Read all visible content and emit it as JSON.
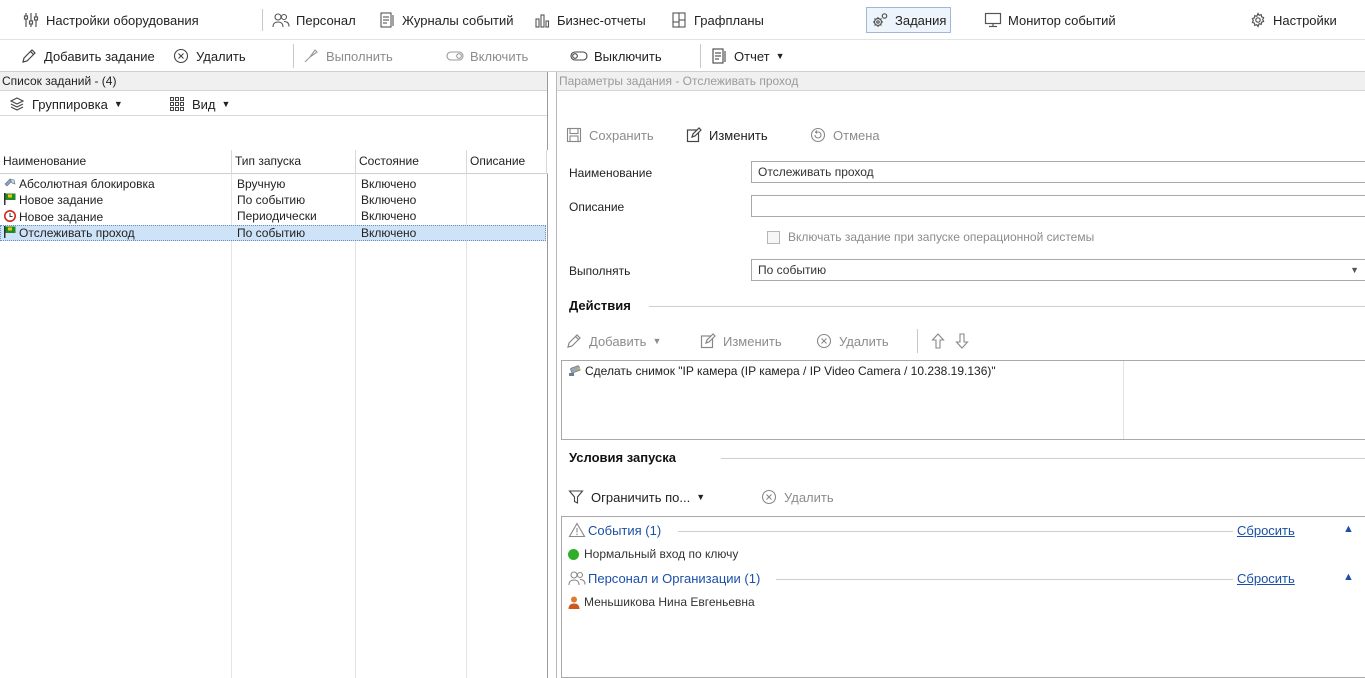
{
  "menu": {
    "items": [
      {
        "label": "Настройки оборудования",
        "icon": "hardware-settings-icon"
      },
      {
        "label": "Персонал",
        "icon": "personnel-icon"
      },
      {
        "label": "Журналы событий",
        "icon": "event-log-icon"
      },
      {
        "label": "Бизнес-отчеты",
        "icon": "business-report-icon"
      },
      {
        "label": "Графпланы",
        "icon": "floor-plan-icon"
      },
      {
        "label": "Задания",
        "icon": "tasks-gear-icon"
      },
      {
        "label": "Монитор событий",
        "icon": "monitor-icon"
      },
      {
        "label": "Настройки",
        "icon": "gear-icon"
      }
    ],
    "active_index": 5
  },
  "toolbar": {
    "add_label": "Добавить задание",
    "delete_label": "Удалить",
    "execute_label": "Выполнить",
    "enable_label": "Включить",
    "disable_label": "Выключить",
    "report_label": "Отчет"
  },
  "left": {
    "header": "Список заданий - (4)",
    "grouping_label": "Группировка",
    "view_label": "Вид",
    "columns": [
      "Наименование",
      "Тип запуска",
      "Состояние",
      "Описание"
    ],
    "rows": [
      {
        "name": "Абсолютная блокировка",
        "launch": "Вручную",
        "state": "Включено",
        "desc": "",
        "icon": "lock-icon"
      },
      {
        "name": "Новое задание",
        "launch": "По событию",
        "state": "Включено",
        "desc": "",
        "icon": "flag-icon"
      },
      {
        "name": "Новое задание",
        "launch": "Периодически",
        "state": "Включено",
        "desc": "",
        "icon": "alarm-clock-icon"
      },
      {
        "name": "Отслеживать проход",
        "launch": "По событию",
        "state": "Включено",
        "desc": "",
        "icon": "flag-icon"
      }
    ],
    "selected_index": 3
  },
  "right": {
    "header": "Параметры задания - Отслеживать проход",
    "save_label": "Сохранить",
    "edit_label": "Изменить",
    "cancel_label": "Отмена",
    "name_label": "Наименование",
    "name_value": "Отслеживать проход",
    "desc_label": "Описание",
    "desc_value": "",
    "os_start_label": "Включать задание при запуске операционной системы",
    "os_start_checked": false,
    "execute_label": "Выполнять",
    "execute_value": "По событию",
    "actions": {
      "title": "Действия",
      "add_label": "Добавить",
      "edit_label": "Изменить",
      "delete_label": "Удалить",
      "items": [
        "Сделать снимок \"IP камера (IP камера / IP Video Camera / 10.238.19.136)\""
      ]
    },
    "conditions": {
      "title": "Условия запуска",
      "limit_label": "Ограничить по...",
      "delete_label": "Удалить",
      "groups": [
        {
          "title": "События (1)",
          "reset": "Сбросить",
          "items": [
            "Нормальный вход по ключу"
          ]
        },
        {
          "title": "Персонал и Организации (1)",
          "reset": "Сбросить",
          "items": [
            "Меньшикова Нина Евгеньевна"
          ]
        }
      ]
    }
  }
}
